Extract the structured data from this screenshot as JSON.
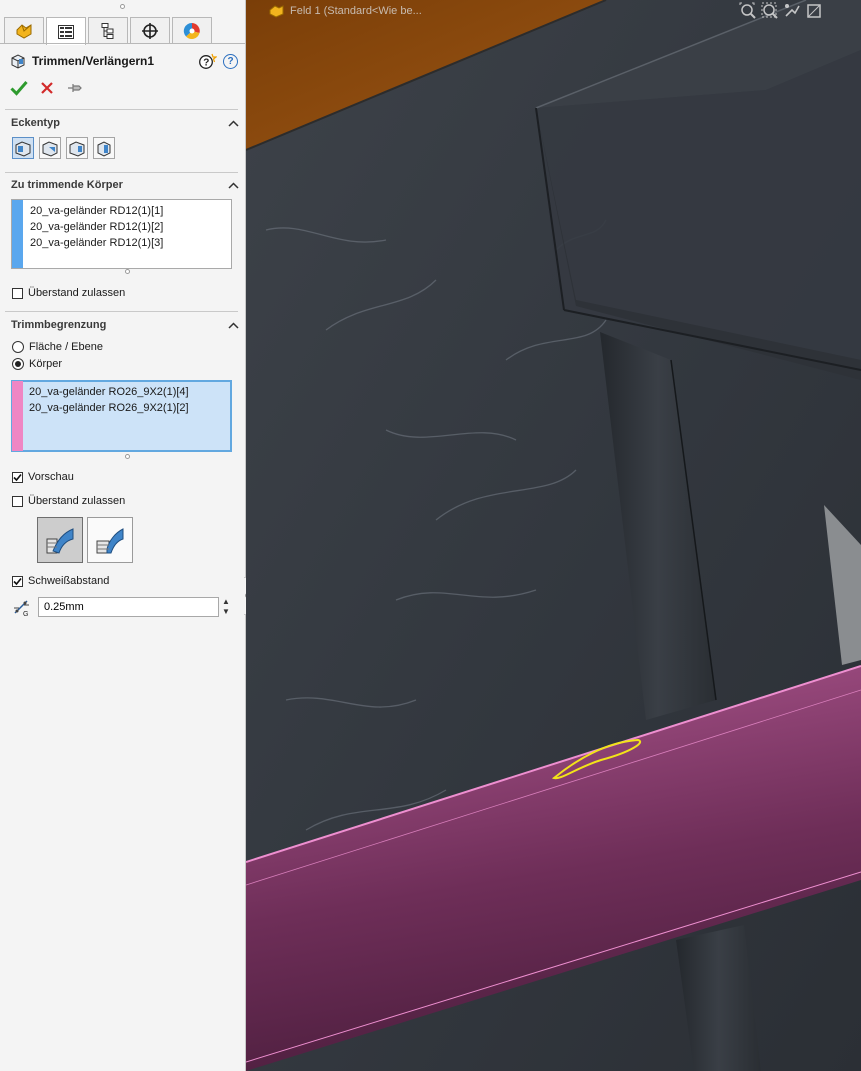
{
  "panel": {
    "tabs": [
      {
        "name": "feature-manager-tab",
        "icon": "feature-tree-icon"
      },
      {
        "name": "property-manager-tab",
        "icon": "property-manager-icon"
      },
      {
        "name": "configuration-manager-tab",
        "icon": "configuration-icon"
      },
      {
        "name": "dimxpert-tab",
        "icon": "crosshair-icon"
      },
      {
        "name": "display-manager-tab",
        "icon": "color-wheel-icon"
      }
    ],
    "title": "Trimmen/Verlängern1",
    "help_label": "?",
    "sections": {
      "corner_type": {
        "label": "Eckentyp"
      },
      "bodies": {
        "label": "Zu trimmende Körper",
        "items": [
          "20_va-geländer RD12(1)[1]",
          "20_va-geländer RD12(1)[2]",
          "20_va-geländer RD12(1)[3]"
        ],
        "bar_color": "#5aa7ee",
        "allow_extension_label": "Überstand zulassen",
        "allow_extension_checked": false
      },
      "boundary": {
        "label": "Trimmbegrenzung",
        "radio_face": "Fläche / Ebene",
        "radio_body": "Körper",
        "selected": "Körper",
        "items": [
          "20_va-geländer RO26_9X2(1)[4]",
          "20_va-geländer RO26_9X2(1)[2]"
        ],
        "bar_color": "#ef86c4",
        "preview_label": "Vorschau",
        "preview_checked": true,
        "allow_extension_label": "Überstand zulassen",
        "allow_extension_checked": false,
        "weld_gap_label": "Schweißabstand",
        "weld_gap_checked": true,
        "weld_gap_value": "0.25mm"
      }
    }
  },
  "viewport": {
    "breadcrumb": "Feld 1  (Standard<Wie be..."
  },
  "colors": {
    "accent": "#2b6fbf",
    "ok_green": "#2e9b2e",
    "cancel_red": "#d22a2a",
    "highlight_pink": "#c06a9e",
    "selection_blue": "#cde3f8"
  }
}
